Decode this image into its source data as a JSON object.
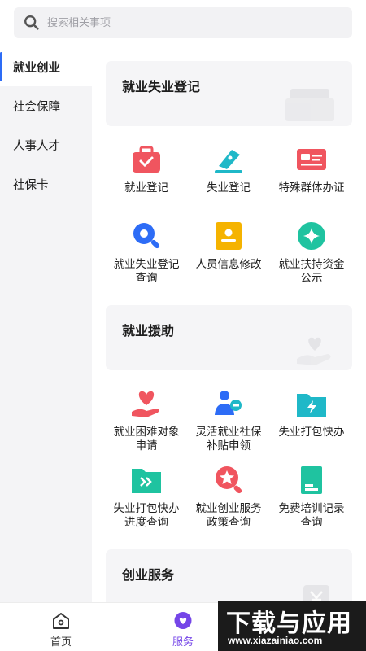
{
  "search": {
    "placeholder": "搜索相关事项"
  },
  "sidebar": {
    "items": [
      {
        "label": "就业创业",
        "active": true
      },
      {
        "label": "社会保障",
        "active": false
      },
      {
        "label": "人事人才",
        "active": false
      },
      {
        "label": "社保卡",
        "active": false
      }
    ]
  },
  "sections": [
    {
      "title": "就业失业登记",
      "items": [
        {
          "label": "就业登记",
          "icon": "briefcase-icon",
          "color": "#f0555f"
        },
        {
          "label": "失业登记",
          "icon": "pen-nib-icon",
          "color": "#1fb8c8"
        },
        {
          "label": "特殊群体办证",
          "icon": "id-card-icon",
          "color": "#f0555f"
        },
        {
          "label": "就业失业登记查询",
          "icon": "magnifier-icon",
          "color": "#2d6cf6"
        },
        {
          "label": "人员信息修改",
          "icon": "profile-book-icon",
          "color": "#f5b300"
        },
        {
          "label": "就业扶持资金公示",
          "icon": "sparkle-icon",
          "color": "#1fc3a0"
        }
      ]
    },
    {
      "title": "就业援助",
      "items": [
        {
          "label": "就业困难对象申请",
          "icon": "heart-hand-icon",
          "color": "#f0555f"
        },
        {
          "label": "灵活就业社保补贴申领",
          "icon": "person-chat-icon",
          "color": "#2d6cf6"
        },
        {
          "label": "失业打包快办",
          "icon": "folder-bolt-icon",
          "color": "#1fb8c8"
        },
        {
          "label": "失业打包快办进度查询",
          "icon": "folder-arrow-icon",
          "color": "#1fc3a0"
        },
        {
          "label": "就业创业服务政策查询",
          "icon": "star-search-icon",
          "color": "#f0555f"
        },
        {
          "label": "免费培训记录查询",
          "icon": "document-icon",
          "color": "#1fc3a0"
        }
      ]
    },
    {
      "title": "创业服务"
    }
  ],
  "tabbar": {
    "items": [
      {
        "label": "首页",
        "icon": "home-icon",
        "active": false
      },
      {
        "label": "服务",
        "icon": "heart-bubble-icon",
        "active": true
      }
    ]
  },
  "watermark": {
    "big": "下载与应用",
    "small": "www.xiazainiao.com"
  },
  "colors": {
    "accent": "#2d6cf6",
    "tab_active": "#7546e8"
  }
}
